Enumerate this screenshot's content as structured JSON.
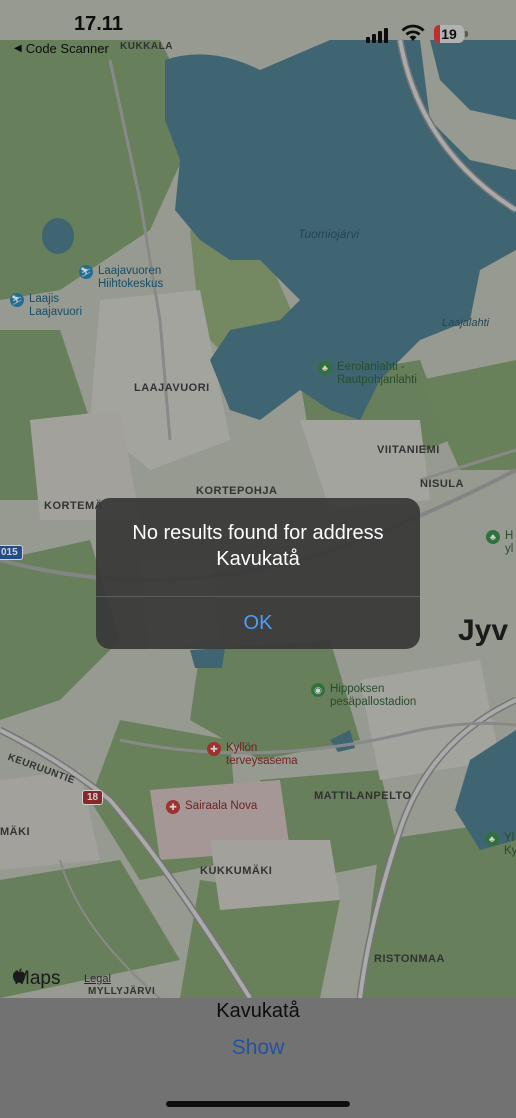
{
  "status_bar": {
    "time": "17.11",
    "back_app": "Code Scanner",
    "battery": "19"
  },
  "map": {
    "water_labels": [
      "Tuomiojärvi",
      "Laajalahti"
    ],
    "district_labels": [
      "LAAJAVUORI",
      "KORTEPOHJA",
      "VIITANIEMI",
      "NISULA",
      "KORTEMÄ",
      "MATTILANPELTO",
      "KUKKUMÄKI",
      "RISTONMAA",
      "MYLLYJÄRVI",
      "KEURUUNTIE",
      "MÄKI",
      "KUKKALA",
      "Jyv"
    ],
    "pois": {
      "ski": [
        "Laajavuoren",
        "Hiihtokeskus"
      ],
      "laajis": [
        "Laajis",
        "Laajavuori"
      ],
      "eerolanlahti": [
        "Eerolanlahti -",
        "Rautpohjanlahti"
      ],
      "hippos": [
        "Hippoksen",
        "pesäpallostadion"
      ],
      "kyllon": [
        "Kyllön",
        "terveysasema"
      ],
      "sairaala": [
        "Sairaala Nova"
      ]
    },
    "road_shields": [
      "015",
      "18"
    ],
    "edge_labels": [
      "H",
      "yl",
      "Yl",
      "Ky"
    ],
    "logo": "Maps",
    "legal": "Legal"
  },
  "alert": {
    "message": "No results found for address Kavukatå",
    "ok_label": "OK"
  },
  "bottom": {
    "address": "Kavukatå",
    "show_label": "Show"
  },
  "colors": {
    "alert_ok": "#4d9cf7",
    "show_link": "#2a66c2",
    "water": "#4d7c8d",
    "forest": "#7e9b6e"
  }
}
